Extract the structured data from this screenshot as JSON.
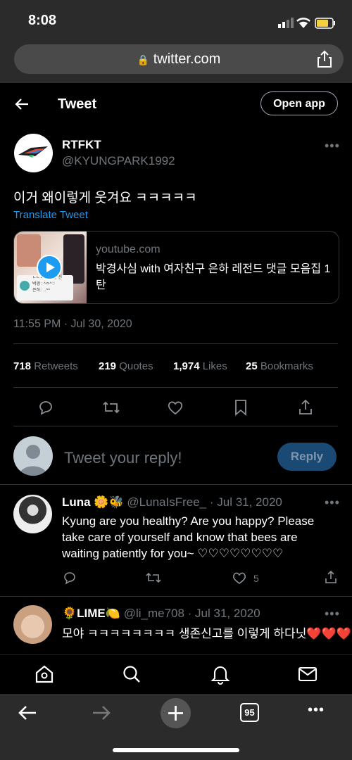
{
  "status": {
    "time": "8:08"
  },
  "browser": {
    "url": "twitter.com",
    "tab_count": "95"
  },
  "header": {
    "title": "Tweet",
    "open_app": "Open app"
  },
  "tweet": {
    "name": "RTFKT",
    "handle": "@KYUNGPARK1992",
    "text": "이거 왜이렇게 웃겨요 ㅋㅋㅋㅋㅋ",
    "translate": "Translate Tweet",
    "card": {
      "domain": "youtube.com",
      "title": "박경사심 with 여자친구 은하 레전드 댓글 모음집 1탄",
      "thumb_line1": "ㄴㄴㄴ 우연창 전",
      "thumb_line2": "박경 : ^ㅇ^♡",
      "thumb_line3": "은하 : ..^^"
    },
    "timestamp": "11:55 PM · Jul 30, 2020",
    "stats": {
      "retweets_n": "718",
      "retweets_l": "Retweets",
      "quotes_n": "219",
      "quotes_l": "Quotes",
      "likes_n": "1,974",
      "likes_l": "Likes",
      "bookmarks_n": "25",
      "bookmarks_l": "Bookmarks"
    }
  },
  "reply_box": {
    "placeholder": "Tweet your reply!",
    "button": "Reply"
  },
  "replies": [
    {
      "name": "Luna",
      "emoji": "🌼🐝",
      "handle_date": "@LunaIsFree_ · Jul 31, 2020",
      "text": "Kyung are you healthy? Are you happy? Please take care of yourself and know that bees are waiting patiently for you~ ♡♡♡♡♡♡♡♡",
      "likes": "5"
    },
    {
      "name": "🌻LIME🍋",
      "handle_date": "@li_me708 · Jul 31, 2020",
      "text": "모야 ㅋㅋㅋㅋㅋㅋㅋㅋ 생존신고를 이렇게 하다닛❤️❤️❤️"
    }
  ],
  "more": "•••",
  "colors": {
    "accent": "#1d9bf0",
    "background": "#000000",
    "text": "#e7e9ea",
    "muted": "#71767b"
  }
}
